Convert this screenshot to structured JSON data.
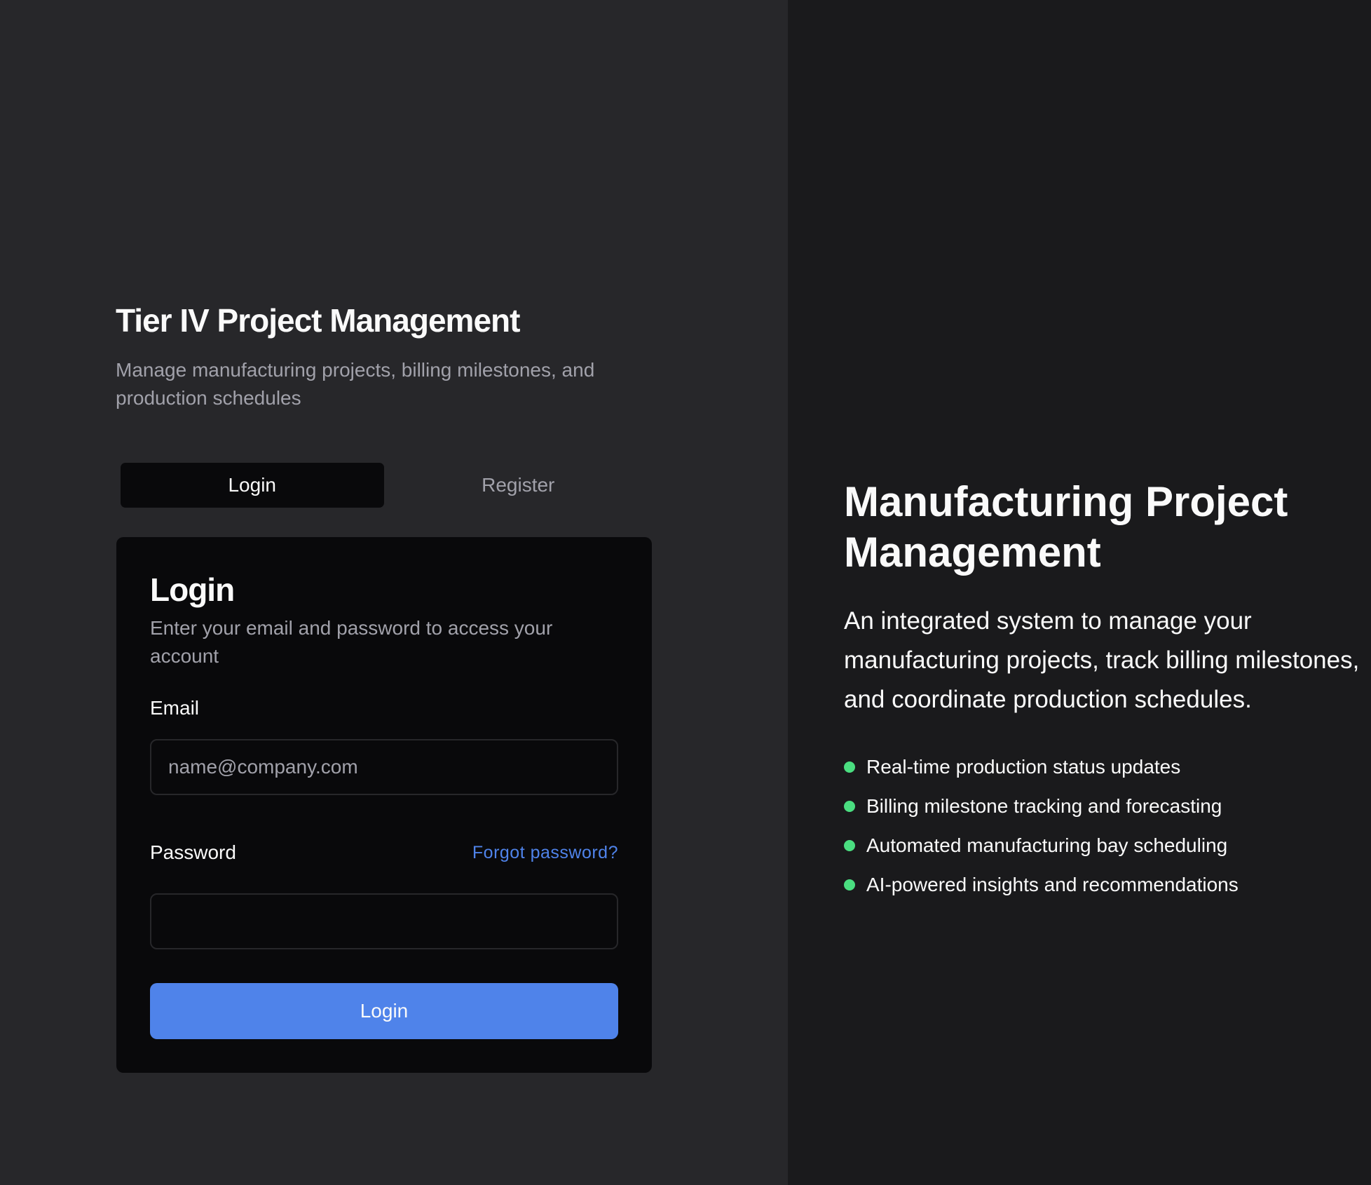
{
  "brand": {
    "title": "Tier IV Project Management",
    "subtitle": "Manage manufacturing projects, billing milestones, and production schedules"
  },
  "tabs": [
    {
      "label": "Login",
      "active": true
    },
    {
      "label": "Register",
      "active": false
    }
  ],
  "login_card": {
    "title": "Login",
    "description": "Enter your email and password to access your account",
    "email": {
      "label": "Email",
      "placeholder": "name@company.com",
      "value": ""
    },
    "password": {
      "label": "Password",
      "value": "",
      "forgot_link": "Forgot password?"
    },
    "submit_label": "Login"
  },
  "hero": {
    "title": "Manufacturing Project Management",
    "description": "An integrated system to manage your manufacturing projects, track billing milestones, and coordinate production schedules.",
    "features": [
      "Real-time production status updates",
      "Billing milestone tracking and forecasting",
      "Automated manufacturing bay scheduling",
      "AI-powered insights and recommendations"
    ],
    "bullet_icon": "dot-icon"
  },
  "colors": {
    "left_background": "#27272a",
    "right_background": "#1a1a1c",
    "card_background": "#09090b",
    "accent": "#4f83ea",
    "bullet": "#4ade80",
    "text_primary": "#fafafa",
    "text_muted": "#a1a1aa"
  }
}
